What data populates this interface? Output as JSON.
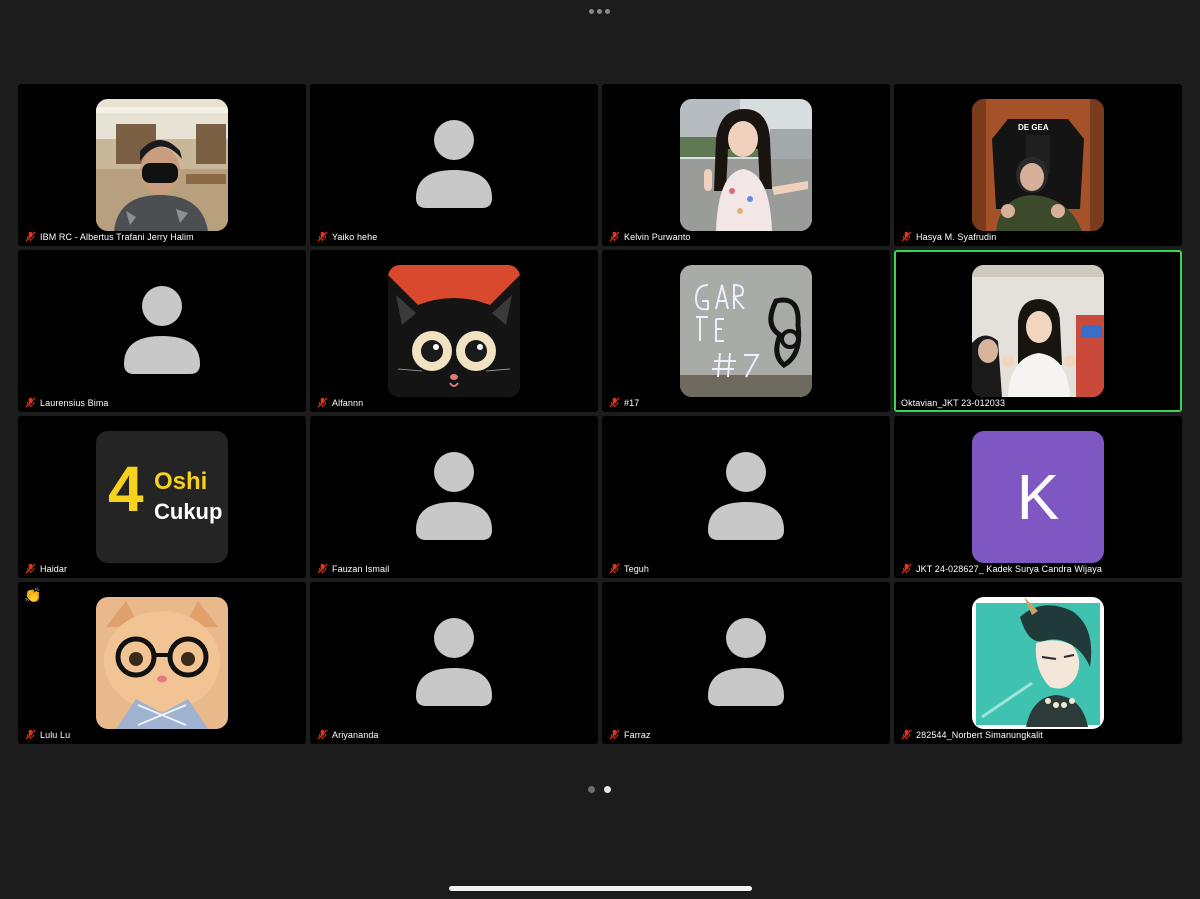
{
  "window": {
    "more_menu": "more-options"
  },
  "participants": [
    {
      "name": "IBM RC - Albertus Trafani Jerry Halim",
      "avatar": "photo",
      "muted": true
    },
    {
      "name": "Yaiko hehe",
      "avatar": "placeholder",
      "muted": true
    },
    {
      "name": "Kelvin Purwanto",
      "avatar": "photo",
      "muted": true
    },
    {
      "name": "Hasya M. Syafrudin",
      "avatar": "photo",
      "muted": true
    },
    {
      "name": "Laurensius Bima",
      "avatar": "placeholder",
      "muted": true
    },
    {
      "name": "Alfannn",
      "avatar": "cat-illustration",
      "muted": true
    },
    {
      "name": "#17",
      "avatar": "photo",
      "muted": true
    },
    {
      "name": "Oktavian_JKT 23-012033",
      "avatar": "photo",
      "muted": false,
      "active_speaker": true
    },
    {
      "name": "Haidar",
      "avatar": "logo",
      "muted": true,
      "logo_text": {
        "number": "4",
        "line1": "Oshi",
        "line2": "Cukup"
      }
    },
    {
      "name": "Fauzan Ismail",
      "avatar": "placeholder",
      "muted": true
    },
    {
      "name": "Teguh",
      "avatar": "placeholder",
      "muted": true
    },
    {
      "name": "JKT 24-028627_ Kadek Surya Candra Wijaya",
      "avatar": "letter",
      "letter": "K",
      "muted": true
    },
    {
      "name": "Lulu Lu",
      "avatar": "photo",
      "muted": true,
      "reaction": "👏"
    },
    {
      "name": "Ariyananda",
      "avatar": "placeholder",
      "muted": true
    },
    {
      "name": "Farraz",
      "avatar": "placeholder",
      "muted": true
    },
    {
      "name": "282544_Norbert Simanungkalit",
      "avatar": "anime-illustration",
      "muted": true
    }
  ],
  "colors": {
    "background": "#1c1c1c",
    "tile": "#000000",
    "active_border": "#3ad353",
    "mute_icon": "#e0341d",
    "placeholder": "#c8c8c8",
    "letter_avatar": "#7e57c2"
  },
  "pagination": {
    "pages": 2,
    "current": 2
  }
}
